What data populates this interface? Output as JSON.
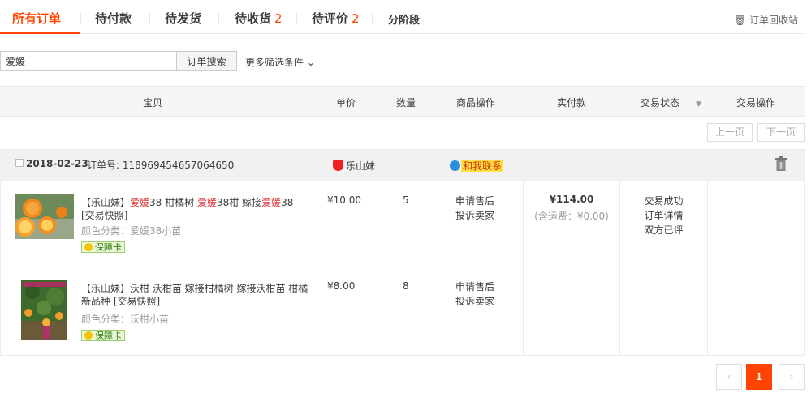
{
  "tabs": [
    {
      "label": "所有订单",
      "count": ""
    },
    {
      "label": "待付款",
      "count": ""
    },
    {
      "label": "待发货",
      "count": ""
    },
    {
      "label": "待收货",
      "count": "2"
    },
    {
      "label": "待评价",
      "count": "2"
    },
    {
      "label": "分阶段",
      "count": ""
    }
  ],
  "recycle_bin": "🗑 订单回收站",
  "search": {
    "value": "爱媛",
    "button": "订单搜索",
    "more_filters": "更多筛选条件 ⌄"
  },
  "table_header": {
    "item": "宝贝",
    "unit_price": "单价",
    "quantity": "数量",
    "item_ops": "商品操作",
    "paid": "实付款",
    "status": "交易状态",
    "status_arrow": "▼",
    "trade_ops": "交易操作"
  },
  "pager_top": {
    "prev": "上一页",
    "next": "下一页"
  },
  "order": {
    "date": "2018-02-23",
    "order_no": "订单号: 118969454657064650",
    "shop": "乐山妹",
    "contact": "和我联系",
    "items": [
      {
        "title_parts": [
          "【乐山妹】",
          "爱媛",
          "38 柑橘树 ",
          "爱媛",
          "38柑 嫁接",
          "爱媛",
          "38 [交易快照]"
        ],
        "spec": "颜色分类：爱媛38小苗",
        "badge": "保障卡",
        "price": "¥10.00",
        "qty": "5",
        "op1": "申请售后",
        "op2": "投诉卖家"
      },
      {
        "title": "【乐山妹】沃柑 沃柑苗 嫁接柑橘树 嫁接沃柑苗 柑橘新品种 [交易快照]",
        "spec": "颜色分类：沃柑小苗",
        "badge": "保障卡",
        "price": "¥8.00",
        "qty": "8",
        "op1": "申请售后",
        "op2": "投诉卖家"
      }
    ],
    "total": "¥114.00",
    "shipping": "(含运费：¥0.00)",
    "status": [
      "交易成功",
      "订单详情",
      "双方已评"
    ]
  },
  "pager_bottom": {
    "prev": "‹",
    "current": "1",
    "next": "›"
  },
  "colors": {
    "accent": "#ff4400",
    "highlight": "#e4393c",
    "header_bg": "#f5f5f5"
  }
}
